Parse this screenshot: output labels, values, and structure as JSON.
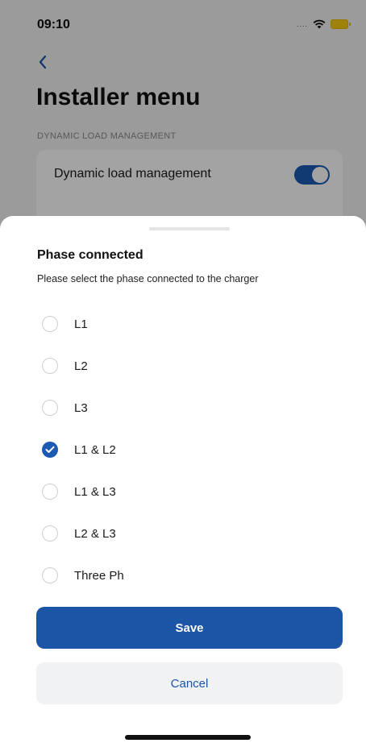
{
  "status_bar": {
    "time": "09:10",
    "signal": "....",
    "icons": [
      "wifi-icon",
      "battery-icon"
    ]
  },
  "background": {
    "back_icon": "chevron-left-icon",
    "title": "Installer menu",
    "section_label": "DYNAMIC LOAD MANAGEMENT",
    "setting": {
      "label": "Dynamic load management",
      "enabled": true
    }
  },
  "sheet": {
    "title": "Phase connected",
    "subtitle": "Please select the phase connected to the charger",
    "options": [
      {
        "label": "L1",
        "selected": false
      },
      {
        "label": "L2",
        "selected": false
      },
      {
        "label": "L3",
        "selected": false
      },
      {
        "label": "L1 & L2",
        "selected": true
      },
      {
        "label": "L1 & L3",
        "selected": false
      },
      {
        "label": "L2 & L3",
        "selected": false
      },
      {
        "label": "Three Ph",
        "selected": false
      }
    ],
    "save_label": "Save",
    "cancel_label": "Cancel"
  },
  "colors": {
    "accent": "#1c55a6",
    "radio_border": "#cfcfd3",
    "cancel_bg": "#f1f2f4"
  }
}
